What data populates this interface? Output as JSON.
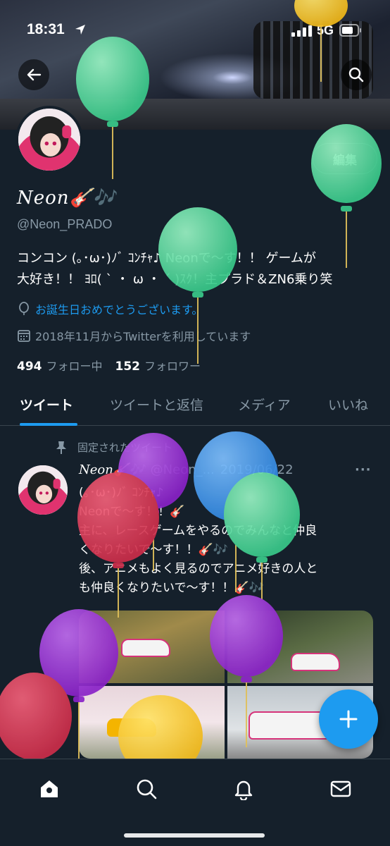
{
  "status_bar": {
    "time": "18:31",
    "network": "5G"
  },
  "header": {
    "edit_label": "編集"
  },
  "profile": {
    "display_name": "𝑁𝑒𝑜𝑛🎸🎶",
    "handle": "@Neon_PRADO",
    "bio": "コンコン (｡･ω･)ﾉﾞ ｺﾝﾁｬ♪ Neonで〜す！！ ゲームが\n大好き！！ ﾖﾛ( ˋ ・ ω ・ ˊ )ｽｸ！主プラド＆ZN6乗り笑",
    "birthday_text": "お誕生日おめでとうございます。",
    "joined_text": "2018年11月からTwitterを利用しています",
    "following_count": "494",
    "following_label": "フォロー中",
    "followers_count": "152",
    "followers_label": "フォロワー"
  },
  "tabs": [
    {
      "label": "ツイート",
      "active": true
    },
    {
      "label": "ツイートと返信"
    },
    {
      "label": "メディア"
    },
    {
      "label": "いいね"
    }
  ],
  "tweet": {
    "pinned_label": "固定されたツイート",
    "name": "𝑁𝑒𝑜𝑛🎸🎶",
    "handle": "@Neon_...",
    "date": "2019/06/22",
    "more": "···",
    "text": "(｡･ω･)ﾉﾞ ｺﾝﾁｬ♪\nNeonで〜す！！🎸\n主に、レースゲームをやるのでみんなと仲良\nくなりたいで〜す！！🎸🎶\n後、アニメもよく見るのでアニメ好きの人と\nも仲良くなりたいで〜す！！🎸🎶"
  },
  "colors": {
    "accent": "#1d9bf0",
    "background": "#15202b",
    "muted": "#8899a6"
  },
  "icons": [
    "arrow-back-icon",
    "search-icon",
    "balloon-icon",
    "calendar-icon",
    "pin-icon",
    "more-icon",
    "plus-icon",
    "home-icon",
    "search-nav-icon",
    "bell-icon",
    "mail-icon"
  ]
}
